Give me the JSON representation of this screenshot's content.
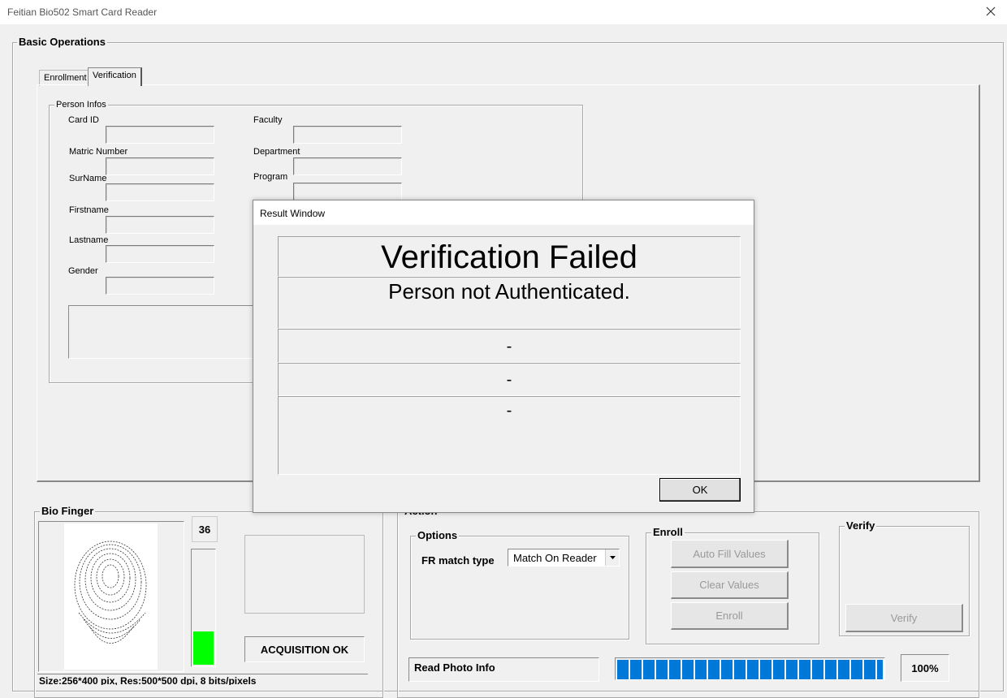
{
  "window": {
    "title": "Feitian Bio502 Smart Card Reader"
  },
  "basic_ops": {
    "title": "Basic Operations"
  },
  "tabs": [
    {
      "label": "Enrollment"
    },
    {
      "label": "Verification"
    }
  ],
  "person": {
    "title": "Person Infos",
    "labels": {
      "card_id": "Card ID",
      "matric": "Matric Number",
      "surname": "SurName",
      "firstname": "Firstname",
      "lastname": "Lastname",
      "gender": "Gender",
      "faculty": "Faculty",
      "department": "Department",
      "program": "Program"
    }
  },
  "bio_finger": {
    "title": "Bio Finger",
    "quality": "36",
    "quality_level": 0.29,
    "status": "ACQUISITION OK",
    "info": "Size:256*400 pix, Res:500*500 dpi, 8 bits/pixels"
  },
  "action": {
    "title": "Action",
    "options_title": "Options",
    "fr_label": "FR match type",
    "fr_value": "Match On Reader",
    "enroll_title": "Enroll",
    "auto_fill": "Auto Fill Values",
    "clear_values": "Clear Values",
    "enroll_btn": "Enroll",
    "verify_title": "Verify",
    "verify_btn": "Verify",
    "read_photo": "Read Photo Info",
    "progress": "100%",
    "progress_value": 1.0
  },
  "result": {
    "title": "Result Window",
    "heading": "Verification Failed",
    "message": "Person not Authenticated.",
    "line1": "-",
    "line2": "-",
    "line3": "-",
    "ok": "OK"
  },
  "colors": {
    "accent_blue": "#0078d7",
    "quality_green": "#00ff00"
  }
}
